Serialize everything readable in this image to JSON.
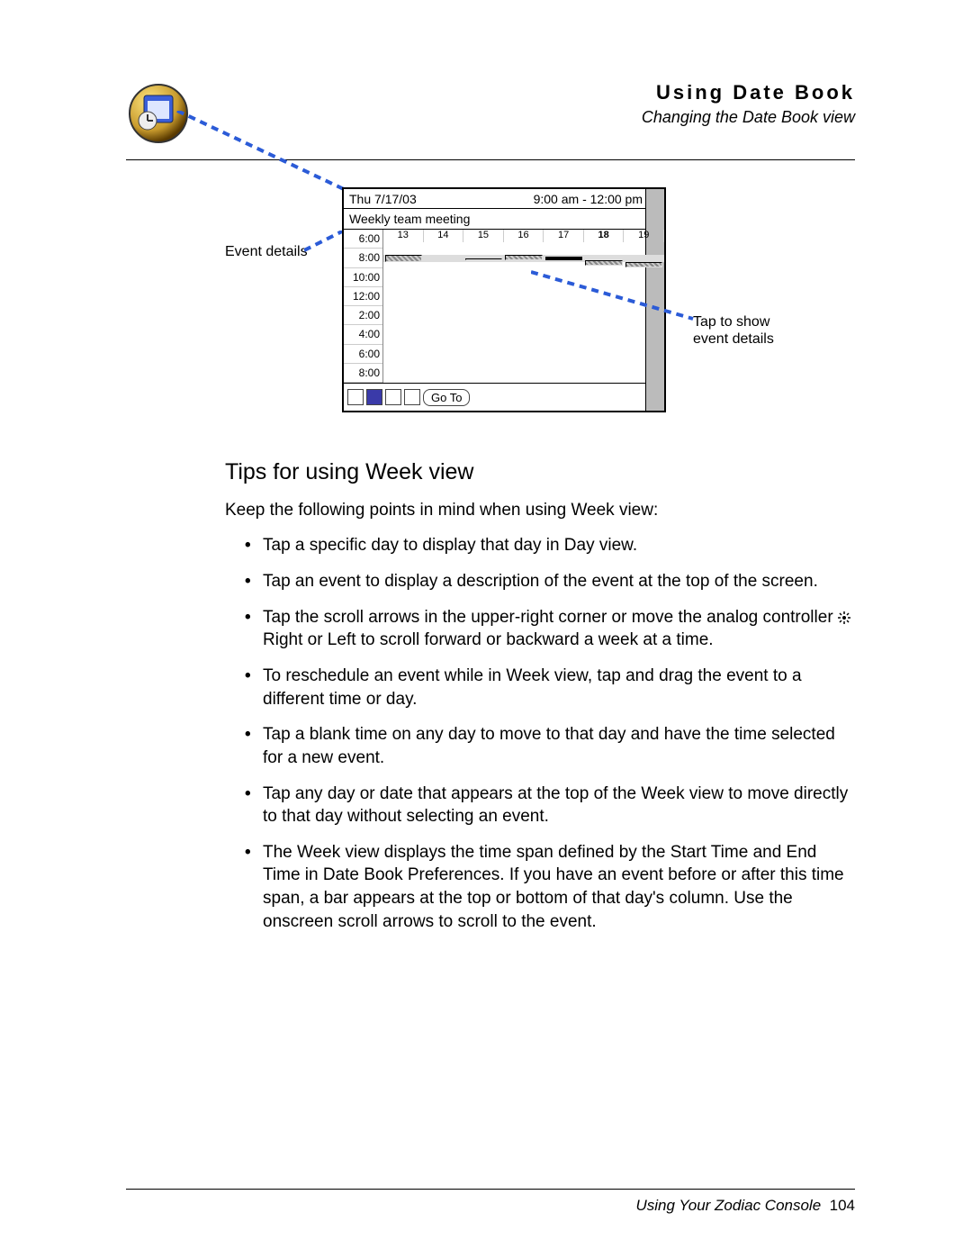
{
  "header": {
    "title": "Using Date Book",
    "subtitle": "Changing the Date Book view"
  },
  "callouts": {
    "left": "Event details",
    "right_line1": "Tap to show",
    "right_line2": "event details"
  },
  "screenshot": {
    "date": "Thu 7/17/03",
    "timerange": "9:00 am - 12:00 pm",
    "eventname": "Weekly team meeting",
    "times": [
      "6:00",
      "8:00",
      "10:00",
      "12:00",
      "2:00",
      "4:00",
      "6:00",
      "8:00"
    ],
    "days": [
      "13",
      "14",
      "15",
      "16",
      "17",
      "18",
      "19"
    ],
    "goto": "Go To",
    "events": [
      {
        "day": 0,
        "start": 0,
        "span": 8,
        "sel": false,
        "bar": false
      },
      {
        "day": 3,
        "start": 0,
        "span": 1,
        "sel": false,
        "bar": true
      },
      {
        "day": 4,
        "start": 2,
        "span": 2,
        "sel": true,
        "bar": false
      },
      {
        "day": 2,
        "start": 4,
        "span": 1,
        "sel": false,
        "bar": false
      },
      {
        "day": 5,
        "start": 6,
        "span": 1,
        "sel": false,
        "bar": true
      },
      {
        "day": 6,
        "start": 8,
        "span": 1,
        "sel": false,
        "bar": true
      }
    ]
  },
  "section": {
    "title": "Tips for using Week view",
    "intro": "Keep the following points in mind when using Week view:"
  },
  "bullets": [
    "Tap a specific day to display that day in Day view.",
    "Tap an event to display a description of the event at the top of the screen.",
    [
      "Tap the scroll arrows in the upper-right corner or move the analog controller ",
      " Right or Left to scroll forward or backward a week at a time."
    ],
    "To reschedule an event while in Week view, tap and drag the event to a different time or day.",
    "Tap a blank time on any day to move to that day and have the time selected for a new event.",
    "Tap any day or date that appears at the top of the Week view to move directly to that day without selecting an event.",
    "The Week view displays the time span defined by the Start Time and End Time in Date Book Preferences. If you have an event before or after this time span, a bar appears at the top or bottom of that day's column. Use the onscreen scroll arrows to scroll to the event."
  ],
  "footer": {
    "text": "Using Your Zodiac Console",
    "page": "104"
  }
}
